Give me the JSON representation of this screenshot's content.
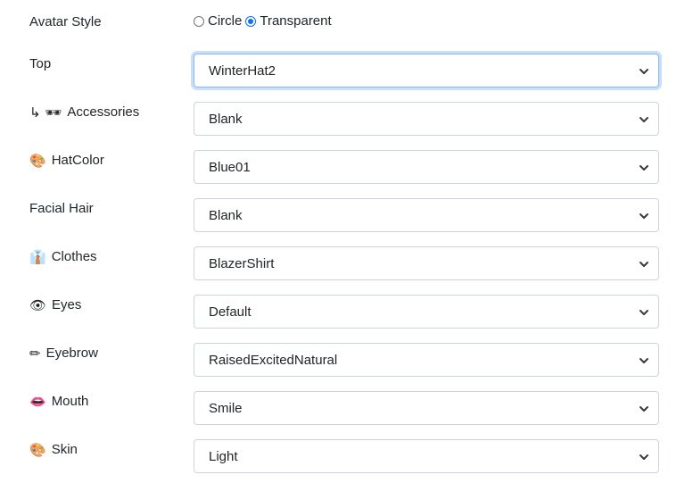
{
  "avatar_style": {
    "label": "Avatar Style",
    "options": [
      {
        "label": "Circle",
        "checked": false
      },
      {
        "label": "Transparent",
        "checked": true
      }
    ]
  },
  "fields": [
    {
      "icon": "",
      "label": "Top",
      "value": "WinterHat2",
      "focused": true
    },
    {
      "icon": "↳ 🕶",
      "label": "Accessories",
      "value": "Blank"
    },
    {
      "icon": "🎨",
      "label": "HatColor",
      "value": "Blue01"
    },
    {
      "icon": "",
      "label": "Facial Hair",
      "value": "Blank"
    },
    {
      "icon": "👔",
      "label": "Clothes",
      "value": "BlazerShirt"
    },
    {
      "icon": "👁",
      "label": "Eyes",
      "value": "Default"
    },
    {
      "icon": "✏",
      "label": "Eyebrow",
      "value": "RaisedExcitedNatural"
    },
    {
      "icon": "👄",
      "label": "Mouth",
      "value": "Smile"
    },
    {
      "icon": "🎨",
      "label": "Skin",
      "value": "Light"
    }
  ],
  "colors": {
    "accent": "#0d6efd",
    "border": "#ced4da",
    "focus_border": "#86b7fe",
    "text": "#212529"
  }
}
